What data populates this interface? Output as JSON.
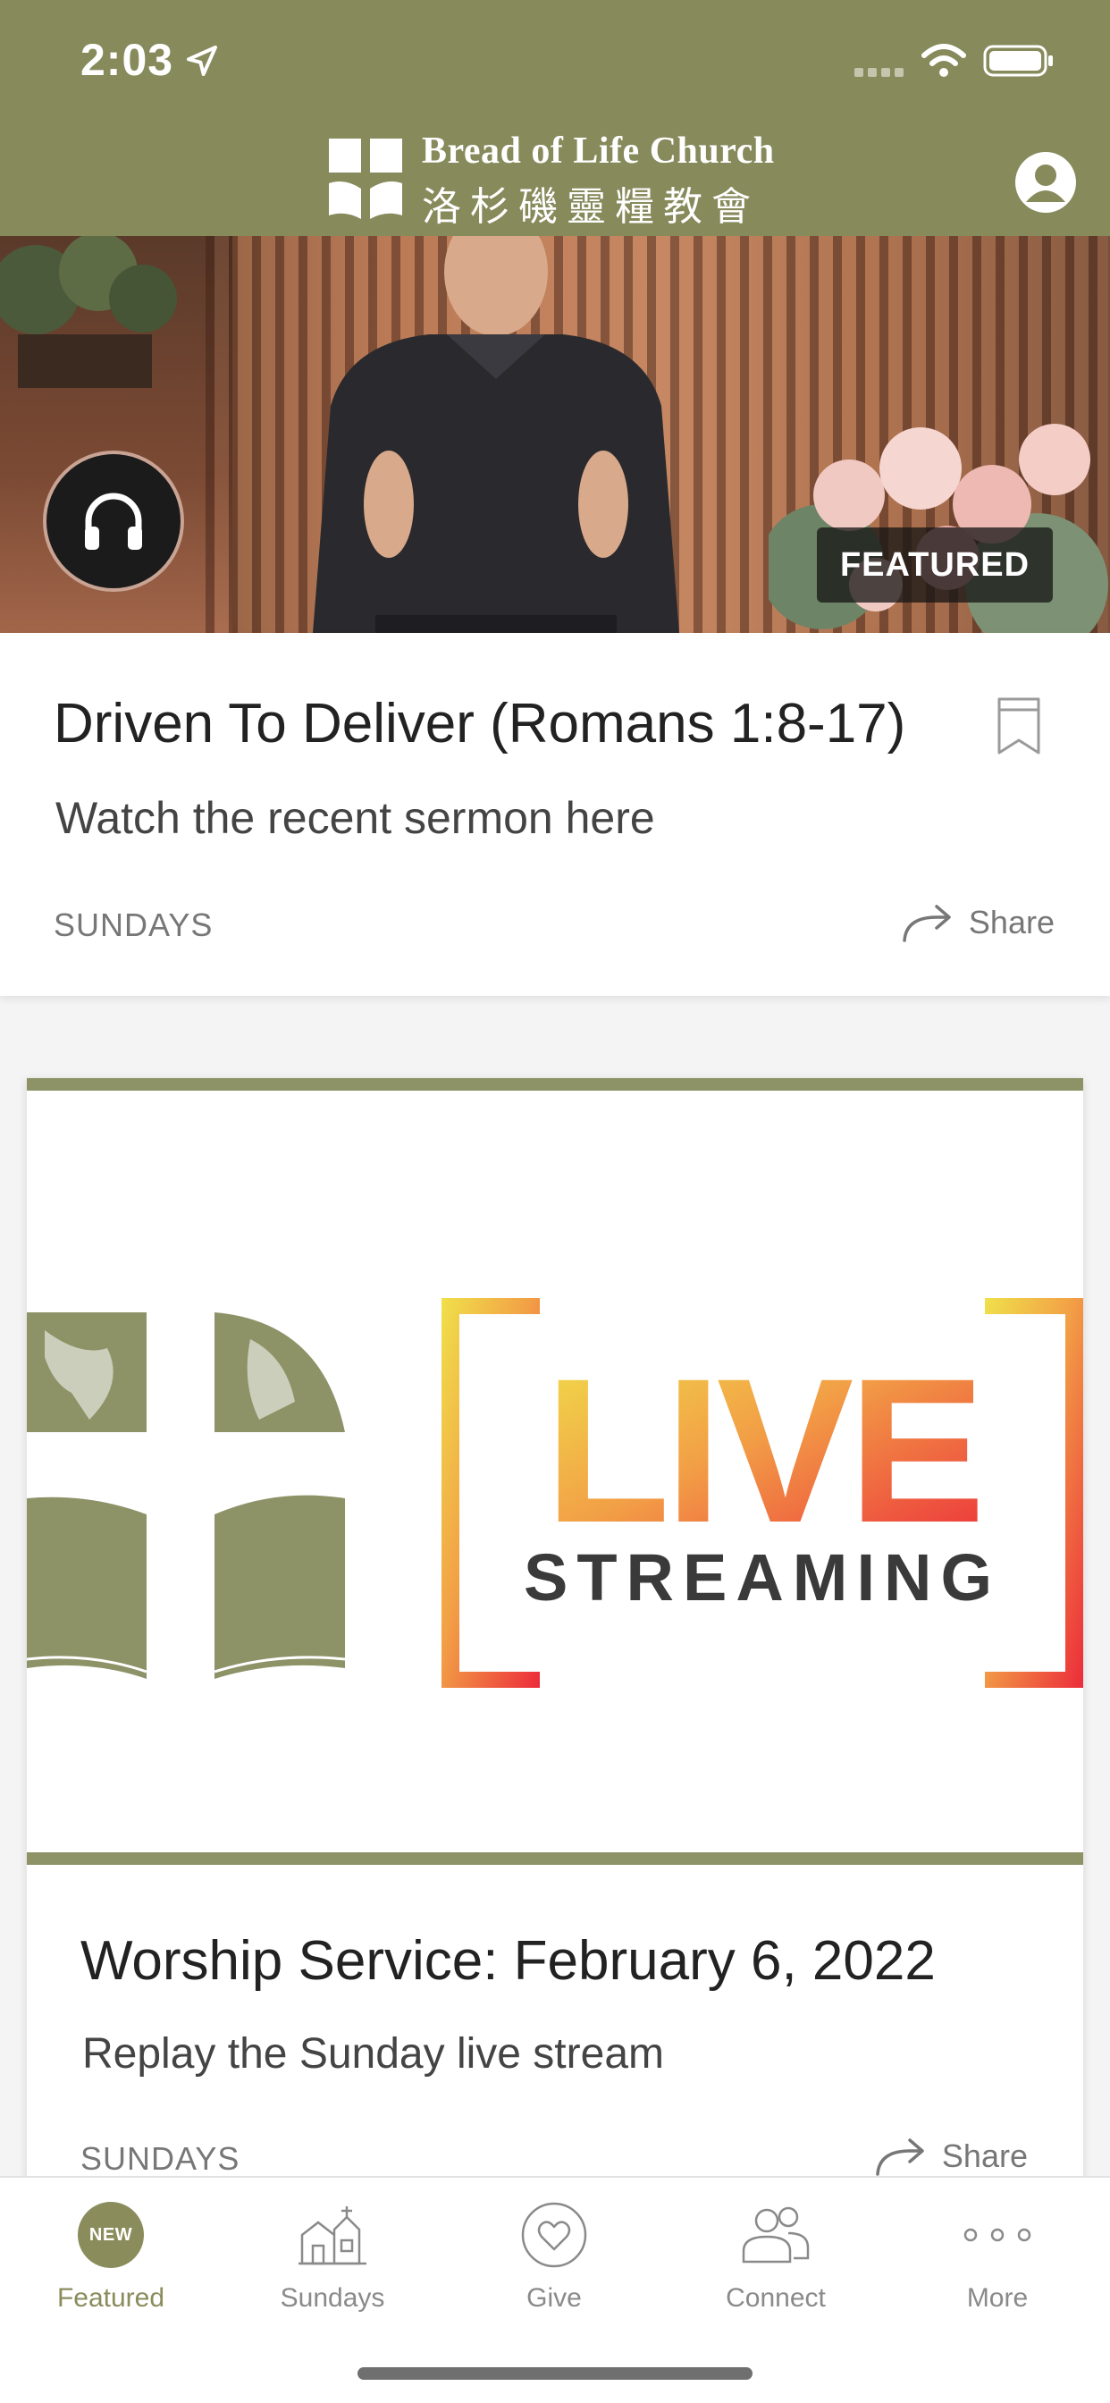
{
  "status_bar": {
    "time": "2:03"
  },
  "header": {
    "brand_name_en": "Bread of Life Church",
    "brand_name_zh": "洛杉磯靈糧教會",
    "accent_color": "#878a5b"
  },
  "featured": {
    "badge": "FEATURED",
    "title": "Driven To Deliver (Romans 1:8-17)",
    "subtitle": "Watch the recent sermon here",
    "category": "SUNDAYS",
    "share_label": "Share"
  },
  "live_item": {
    "banner_word_1": "LIVE",
    "banner_word_2": "STREAMING",
    "title": "Worship Service: February 6, 2022",
    "subtitle": "Replay the Sunday live stream",
    "category": "SUNDAYS",
    "share_label": "Share"
  },
  "tabs": [
    {
      "label": "Featured",
      "badge": "NEW",
      "icon": "new-badge-icon",
      "active": true
    },
    {
      "label": "Sundays",
      "icon": "church-icon",
      "active": false
    },
    {
      "label": "Give",
      "icon": "heart-icon",
      "active": false
    },
    {
      "label": "Connect",
      "icon": "people-icon",
      "active": false
    },
    {
      "label": "More",
      "icon": "more-dots-icon",
      "active": false
    }
  ]
}
